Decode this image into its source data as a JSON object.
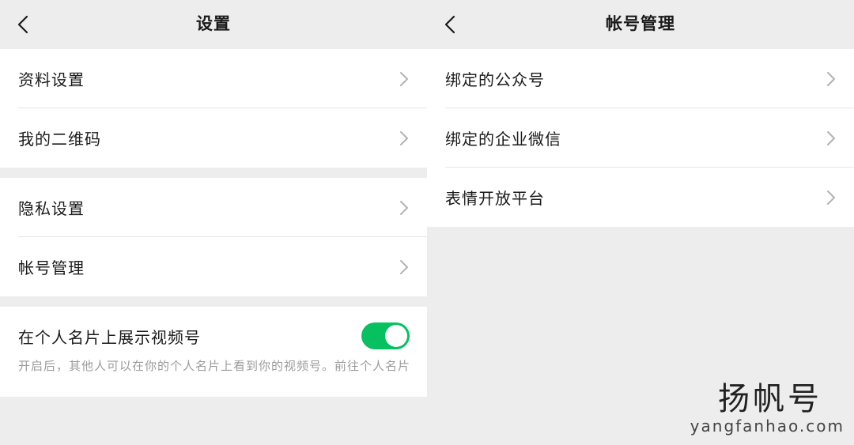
{
  "left": {
    "title": "设置",
    "back_icon": "chevron-left-icon",
    "group1": [
      {
        "label": "资料设置"
      },
      {
        "label": "我的二维码"
      }
    ],
    "group2": [
      {
        "label": "隐私设置"
      },
      {
        "label": "帐号管理"
      }
    ],
    "toggle": {
      "label": "在个人名片上展示视频号",
      "on": true,
      "description": "开启后，其他人可以在你的个人名片上看到你的视频号。前往个人名片"
    }
  },
  "right": {
    "title": "帐号管理",
    "back_icon": "chevron-left-icon",
    "items": [
      {
        "label": "绑定的公众号"
      },
      {
        "label": "绑定的企业微信"
      },
      {
        "label": "表情开放平台"
      }
    ]
  },
  "watermark": {
    "title": "扬帆号",
    "url": "yangfanhao.com"
  },
  "colors": {
    "background": "#ededed",
    "cell": "#ffffff",
    "switch_on": "#07c160",
    "chevron": "#b2b2b2",
    "description": "#9b9b9b"
  }
}
